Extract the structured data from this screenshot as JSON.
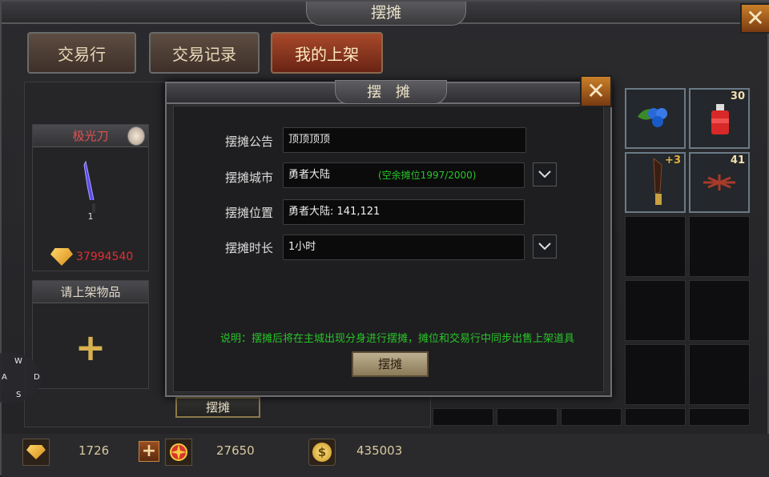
{
  "window": {
    "title": "摆摊",
    "close_label": "✕"
  },
  "tabs": [
    {
      "label": "交易行",
      "active": false
    },
    {
      "label": "交易记录",
      "active": false
    },
    {
      "label": "我的上架",
      "active": true
    }
  ],
  "stall_card": {
    "item_name": "极光刀",
    "item_count": "1",
    "price": "37994540"
  },
  "list_card": {
    "title": "请上架物品",
    "add_symbol": "+"
  },
  "under_button": {
    "label": "摆摊"
  },
  "inventory": {
    "slots": [
      {
        "count": "30"
      },
      {
        "count": "+3"
      },
      {
        "count": "41"
      }
    ]
  },
  "minimap": {
    "w": "W",
    "d": "D",
    "s": "S",
    "a": "A"
  },
  "bottom": {
    "diamond": "1726",
    "emblem_value": "27650",
    "gold": "435003",
    "plus_label": "+"
  },
  "dialog": {
    "title": "摆 摊",
    "close_label": "✕",
    "fields": [
      {
        "label": "摆摊公告",
        "value": "顶顶顶顶"
      },
      {
        "label": "摆摊城市",
        "value": "勇者大陆",
        "extra": "(空余摊位1997/2000)"
      },
      {
        "label": "摆摊位置",
        "value": "勇者大陆: 141,121"
      },
      {
        "label": "摆摊时长",
        "value": "1小时"
      }
    ],
    "note": "说明：摆摊后将在主城出现分身进行摆摊，摊位和交易行中同步出售上架道具",
    "confirm_label": "摆摊"
  },
  "colors": {
    "note_green": "#28c428",
    "price_red": "#e03030",
    "accent_orange": "#c9802a"
  }
}
